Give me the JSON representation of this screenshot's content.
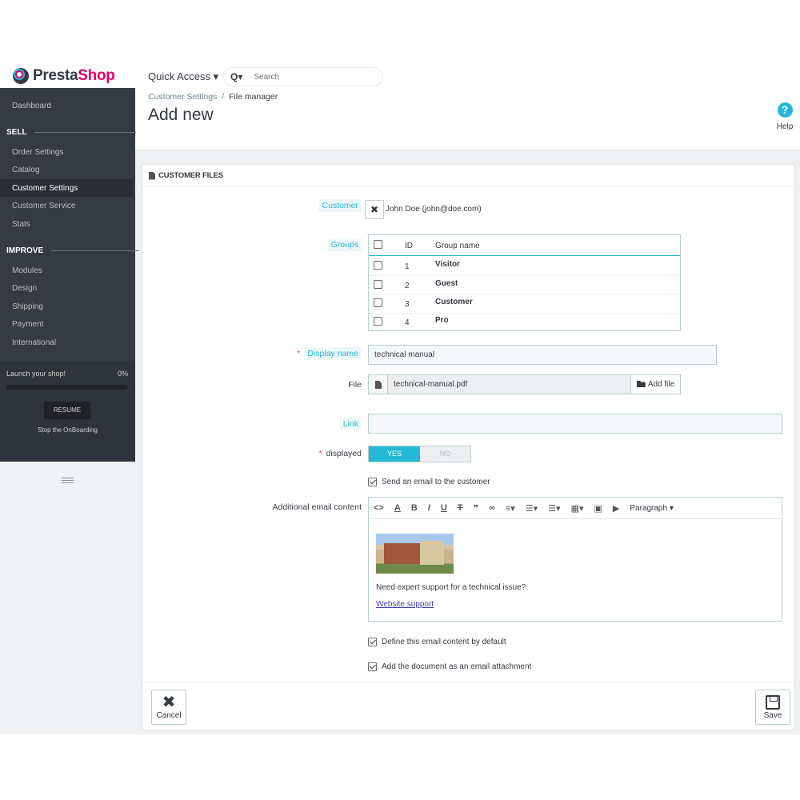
{
  "header": {
    "logo_part1": "Presta",
    "logo_part2": "Shop",
    "quick_access": "Quick Access ▾",
    "search_placeholder": "Search",
    "search_icon": "magnifier-dropdown-icon"
  },
  "breadcrumb": {
    "parent": "Customer Settings",
    "sep": "/",
    "current": "File manager"
  },
  "page_title": "Add new",
  "help_label": "Help",
  "help_glyph": "?",
  "sidebar": {
    "dashboard": "Dashboard",
    "sell_section": "SELL",
    "sell_items": [
      "Order Settings",
      "Catalog",
      "Customer Settings",
      "Customer Service",
      "Stats"
    ],
    "improve_section": "IMPROVE",
    "improve_items": [
      "Modules",
      "Design",
      "Shipping",
      "Payment",
      "International"
    ],
    "active_item": "Customer Settings"
  },
  "onboarding": {
    "title": "Launch your shop!",
    "percent": "0%",
    "progress": 0,
    "resume": "RESUME",
    "stop": "Stop the OnBoarding"
  },
  "panel": {
    "title": "CUSTOMER FILES",
    "customer_label": "Customer",
    "customer_value": "John Doe (john@doe.com)",
    "customer_remove_glyph": "✖",
    "groups_label": "Groups",
    "groups_head": {
      "id": "ID",
      "name": "Group name"
    },
    "groups": [
      {
        "id": "1",
        "name": "Visitor"
      },
      {
        "id": "2",
        "name": "Guest"
      },
      {
        "id": "3",
        "name": "Customer"
      },
      {
        "id": "4",
        "name": "Pro"
      }
    ],
    "required_mark": "*",
    "display_name_label": "Display name",
    "display_name_value": "technical manual",
    "file_label": "File",
    "file_name": "technical-manual.pdf",
    "add_file": "Add file",
    "link_label": "Link",
    "link_value": "",
    "displayed_label": "displayed",
    "yes": "YES",
    "no": "NO",
    "send_email": "Send an email to the customer",
    "additional_label": "Additional email content",
    "paragraph": "Paragraph ▾",
    "editor_text": "Need expert support for a technical issue?",
    "editor_link": "Website support",
    "define_default": "Define this email content by default",
    "attach_doc": "Add the document as an email attachment"
  },
  "footer": {
    "cancel": "Cancel",
    "cancel_glyph": "✖",
    "save": "Save"
  },
  "colors": {
    "accent": "#25b9d7",
    "sidebar": "#363a41",
    "brand_pink": "#df0067"
  }
}
